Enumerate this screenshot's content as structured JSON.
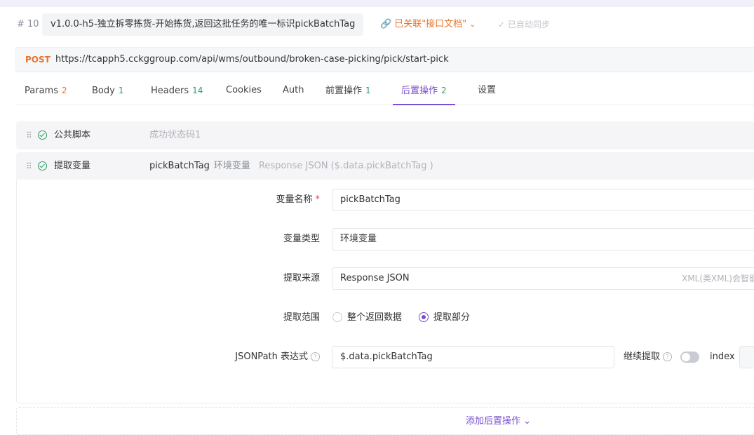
{
  "header": {
    "index": "# 10",
    "title": "v1.0.0-h5-独立拆零拣货-开始拣货,返回这批任务的唯一标识pickBatchTag",
    "linked_label": "已关联\"接口文档\"",
    "auto_sync_label": "已自动同步"
  },
  "request": {
    "method": "POST",
    "url": "https://tcapph5.cckggroup.com/api/wms/outbound/broken-case-picking/pick/start-pick"
  },
  "tabs": [
    {
      "label": "Params",
      "count": "2"
    },
    {
      "label": "Body",
      "count": "1"
    },
    {
      "label": "Headers",
      "count": "14"
    },
    {
      "label": "Cookies",
      "count": ""
    },
    {
      "label": "Auth",
      "count": ""
    },
    {
      "label": "前置操作",
      "count": "1"
    },
    {
      "label": "后置操作",
      "count": "2"
    },
    {
      "label": "设置",
      "count": ""
    }
  ],
  "active_tab": "后置操作",
  "post_ops": [
    {
      "name": "公共脚本",
      "desc": "成功状态码1"
    },
    {
      "name": "提取变量",
      "var": "pickBatchTag",
      "type": "环境变量",
      "source": "Response JSON ($.data.pickBatchTag )"
    }
  ],
  "form": {
    "var_name_label": "变量名称",
    "required_mark": "*",
    "var_name_value": "pickBatchTag",
    "var_type_label": "变量类型",
    "var_type_value": "环境变量",
    "source_label": "提取来源",
    "source_value": "Response JSON",
    "source_hint": "XML(类XML)会智能转",
    "scope_label": "提取范围",
    "scope_options": [
      "整个返回数据",
      "提取部分"
    ],
    "scope_selected": "提取部分",
    "jsonpath_label": "JSONPath 表达式",
    "jsonpath_value": "$.data.pickBatchTag",
    "continue_label": "继续提取",
    "continue_enabled": false,
    "index_label": "index"
  },
  "add_button": "添加后置操作",
  "colors": {
    "accent": "#7a4fcf",
    "orange": "#e8742a",
    "green": "#2f9e68"
  }
}
